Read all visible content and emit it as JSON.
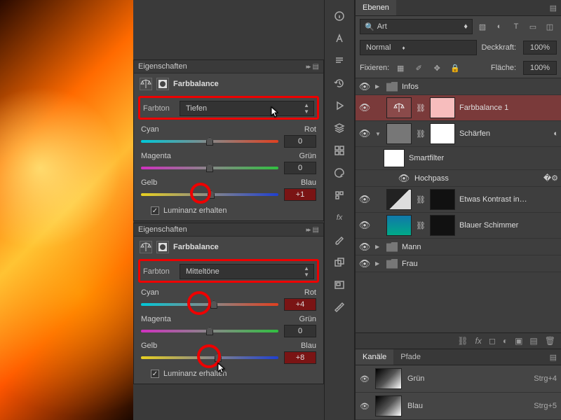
{
  "properties": {
    "panel_title": "Eigenschaften",
    "section_title": "Farbbalance",
    "tone_label": "Farbton",
    "luminance_label": "Luminanz erhalten",
    "sliders": {
      "cyan": "Cyan",
      "red": "Rot",
      "magenta": "Magenta",
      "green": "Grün",
      "yellow": "Gelb",
      "blue": "Blau"
    },
    "panel1": {
      "tone_value": "Tiefen",
      "cr": {
        "value": "0",
        "pos": 50
      },
      "mg": {
        "value": "0",
        "pos": 50
      },
      "yb": {
        "value": "+1",
        "pos": 51
      }
    },
    "panel2": {
      "tone_value": "Mitteltöne",
      "cr": {
        "value": "+4",
        "pos": 53
      },
      "mg": {
        "value": "0",
        "pos": 50
      },
      "yb": {
        "value": "+8",
        "pos": 56
      }
    }
  },
  "layers_panel": {
    "tab": "Ebenen",
    "search_kind": "Art",
    "blend_mode": "Normal",
    "opacity_label": "Deckkraft:",
    "opacity_value": "100%",
    "lock_label": "Fixieren:",
    "fill_label": "Fläche:",
    "fill_value": "100%",
    "items": [
      {
        "type": "group",
        "name": "Infos",
        "open": false
      },
      {
        "type": "adj",
        "name": "Farbbalance 1",
        "selected": true
      },
      {
        "type": "smart",
        "name": "Schärfen"
      },
      {
        "type": "filterlabel",
        "name": "Smartfilter"
      },
      {
        "type": "filter",
        "name": "Hochpass"
      },
      {
        "type": "adjthumb",
        "name": "Etwas Kontrast in…"
      },
      {
        "type": "tealthumb",
        "name": "Blauer Schimmer"
      },
      {
        "type": "group",
        "name": "Mann",
        "open": false
      },
      {
        "type": "group",
        "name": "Frau",
        "open": false
      }
    ]
  },
  "channels_panel": {
    "tabs": {
      "channels": "Kanäle",
      "paths": "Pfade"
    },
    "items": [
      {
        "name": "Grün",
        "shortcut": "Strg+4"
      },
      {
        "name": "Blau",
        "shortcut": "Strg+5"
      }
    ]
  },
  "icons": {
    "eye": "◉",
    "info": "ⓘ",
    "link": "⛓",
    "fx": "fx",
    "mask": "◻",
    "adjust": "◐",
    "newgrp": "▣",
    "new": "▤",
    "trash": "🗑"
  }
}
